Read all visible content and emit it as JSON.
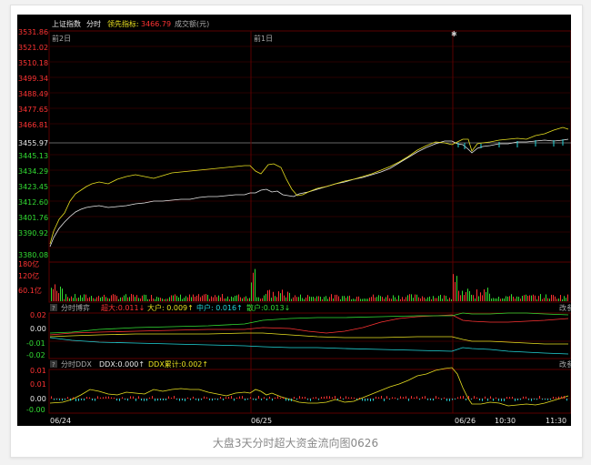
{
  "header": {
    "index_name": "上证指数",
    "mode": "分时",
    "leading_label": "领先指标:",
    "leading_value": "3466.79",
    "volume_label": "成交额(元)"
  },
  "price_axis": [
    "3531.86",
    "3521.02",
    "3510.18",
    "3499.34",
    "3488.49",
    "3477.65",
    "3466.81",
    "3455.97",
    "3445.13",
    "3434.29",
    "3423.45",
    "3412.60",
    "3401.76",
    "3390.92",
    "3380.08"
  ],
  "day_labels": [
    "前2日",
    "前1日"
  ],
  "volume_axis": [
    "180亿",
    "120亿",
    "60.1亿"
  ],
  "game": {
    "help": "?",
    "title": "分时博弈",
    "super": "超大:0.011↓",
    "big": "大户: 0.009↑",
    "mid": "中户: 0.016↑",
    "small": "散户:0.013↓",
    "side": "改参",
    "axis": [
      "0.02",
      "0.00",
      "-0.01",
      "-0.02"
    ]
  },
  "ddx": {
    "help": "?",
    "title": "分时DDX",
    "ddx_value": "DDX:0.000↑",
    "ddx_total": "DDX累计:0.002↑",
    "side": "改参",
    "axis": [
      "0.01",
      "0.01",
      "0.00",
      "-0.00"
    ]
  },
  "time_axis": [
    "06/24",
    "06/25",
    "06/26",
    "10:30",
    "11:30"
  ],
  "colors": {
    "up": "#ff3333",
    "down": "#33dd33",
    "yellow": "#e8e020",
    "white": "#e8e8e8",
    "cyan": "#22d4d8",
    "grid": "#3a0000"
  },
  "caption": "大盘3天分时超大资金流向图0626"
}
